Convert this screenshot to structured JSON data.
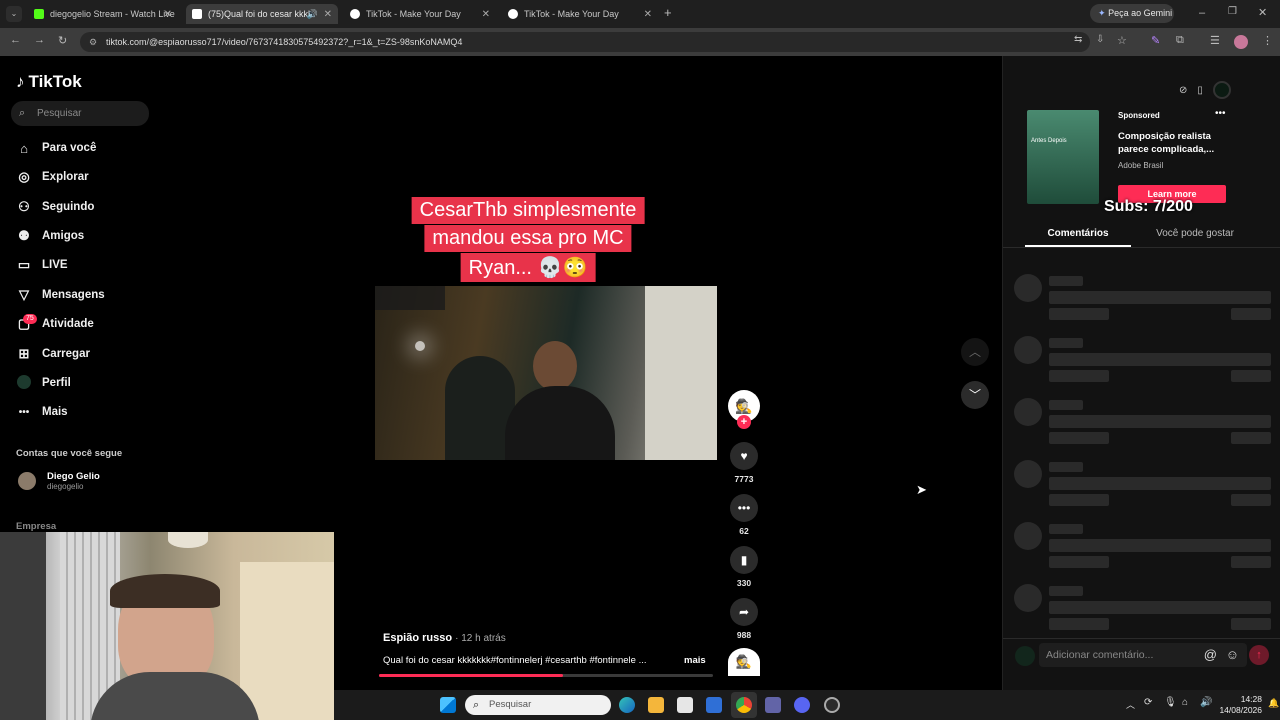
{
  "browser": {
    "tabs": [
      {
        "label": "diegogelio Stream - Watch Live",
        "favicon_color": "#53fc18"
      },
      {
        "label": "(75)Qual foi do cesar kkkk",
        "favicon_color": "#ffffff"
      },
      {
        "label": "TikTok - Make Your Day",
        "favicon_color": "#ffffff"
      },
      {
        "label": "TikTok - Make Your Day",
        "favicon_color": "#ffffff"
      }
    ],
    "gemini_button": "Peça ao Gemini",
    "url": "tiktok.com/@espiaorusso717/video/7673741830575492372?_r=1&_t=ZS-98snKoNAMQ4"
  },
  "tiktok": {
    "logo_text": "TikTok",
    "search_placeholder": "Pesquisar",
    "nav": [
      {
        "label": "Para você",
        "icon": "home-icon"
      },
      {
        "label": "Explorar",
        "icon": "compass-icon"
      },
      {
        "label": "Seguindo",
        "icon": "following-icon"
      },
      {
        "label": "Amigos",
        "icon": "friends-icon"
      },
      {
        "label": "LIVE",
        "icon": "live-icon"
      },
      {
        "label": "Mensagens",
        "icon": "messages-icon"
      },
      {
        "label": "Atividade",
        "icon": "activity-icon"
      },
      {
        "label": "Carregar",
        "icon": "upload-icon"
      },
      {
        "label": "Perfil",
        "icon": "profile-icon"
      },
      {
        "label": "Mais",
        "icon": "more-icon"
      }
    ],
    "activity_badge": "75",
    "following_header": "Contas que você segue",
    "followed_account": {
      "name": "Diego Gelio",
      "handle": "diegogelio"
    },
    "company_header": "Empresa"
  },
  "video": {
    "caption_lines": [
      "CesarThb simplesmente",
      "mandou essa pro MC",
      "Ryan... 💀😳"
    ],
    "author": "Espião russo",
    "posted": "· 12 h atrás",
    "description": "Qual foi do cesar kkkkkkk#fontinnelerj #cesarthb #fontinnele ...",
    "more_label": "mais",
    "progress": 0.55,
    "actions": [
      {
        "name": "like",
        "icon": "heart-icon",
        "count": "7773"
      },
      {
        "name": "comment",
        "icon": "comment-icon",
        "count": "62"
      },
      {
        "name": "save",
        "icon": "bookmark-icon",
        "count": "330"
      },
      {
        "name": "share",
        "icon": "share-icon",
        "count": "988"
      }
    ]
  },
  "ad": {
    "sponsored": "Sponsored",
    "title": "Composição realista parece complicada,...",
    "advertiser": "Adobe Brasil",
    "cta": "Learn more",
    "thumb_text": "Antes Depois"
  },
  "overlay_subs": "Subs: 7/200",
  "right_tabs": {
    "comments": "Comentários",
    "suggested": "Você pode gostar"
  },
  "comment_input_placeholder": "Adicionar comentário...",
  "taskbar": {
    "search_placeholder": "Pesquisar",
    "time": "14:28",
    "date": "14/08/2026"
  },
  "colors": {
    "accent": "#fe2c55",
    "caption_bg": "#e8334a"
  }
}
